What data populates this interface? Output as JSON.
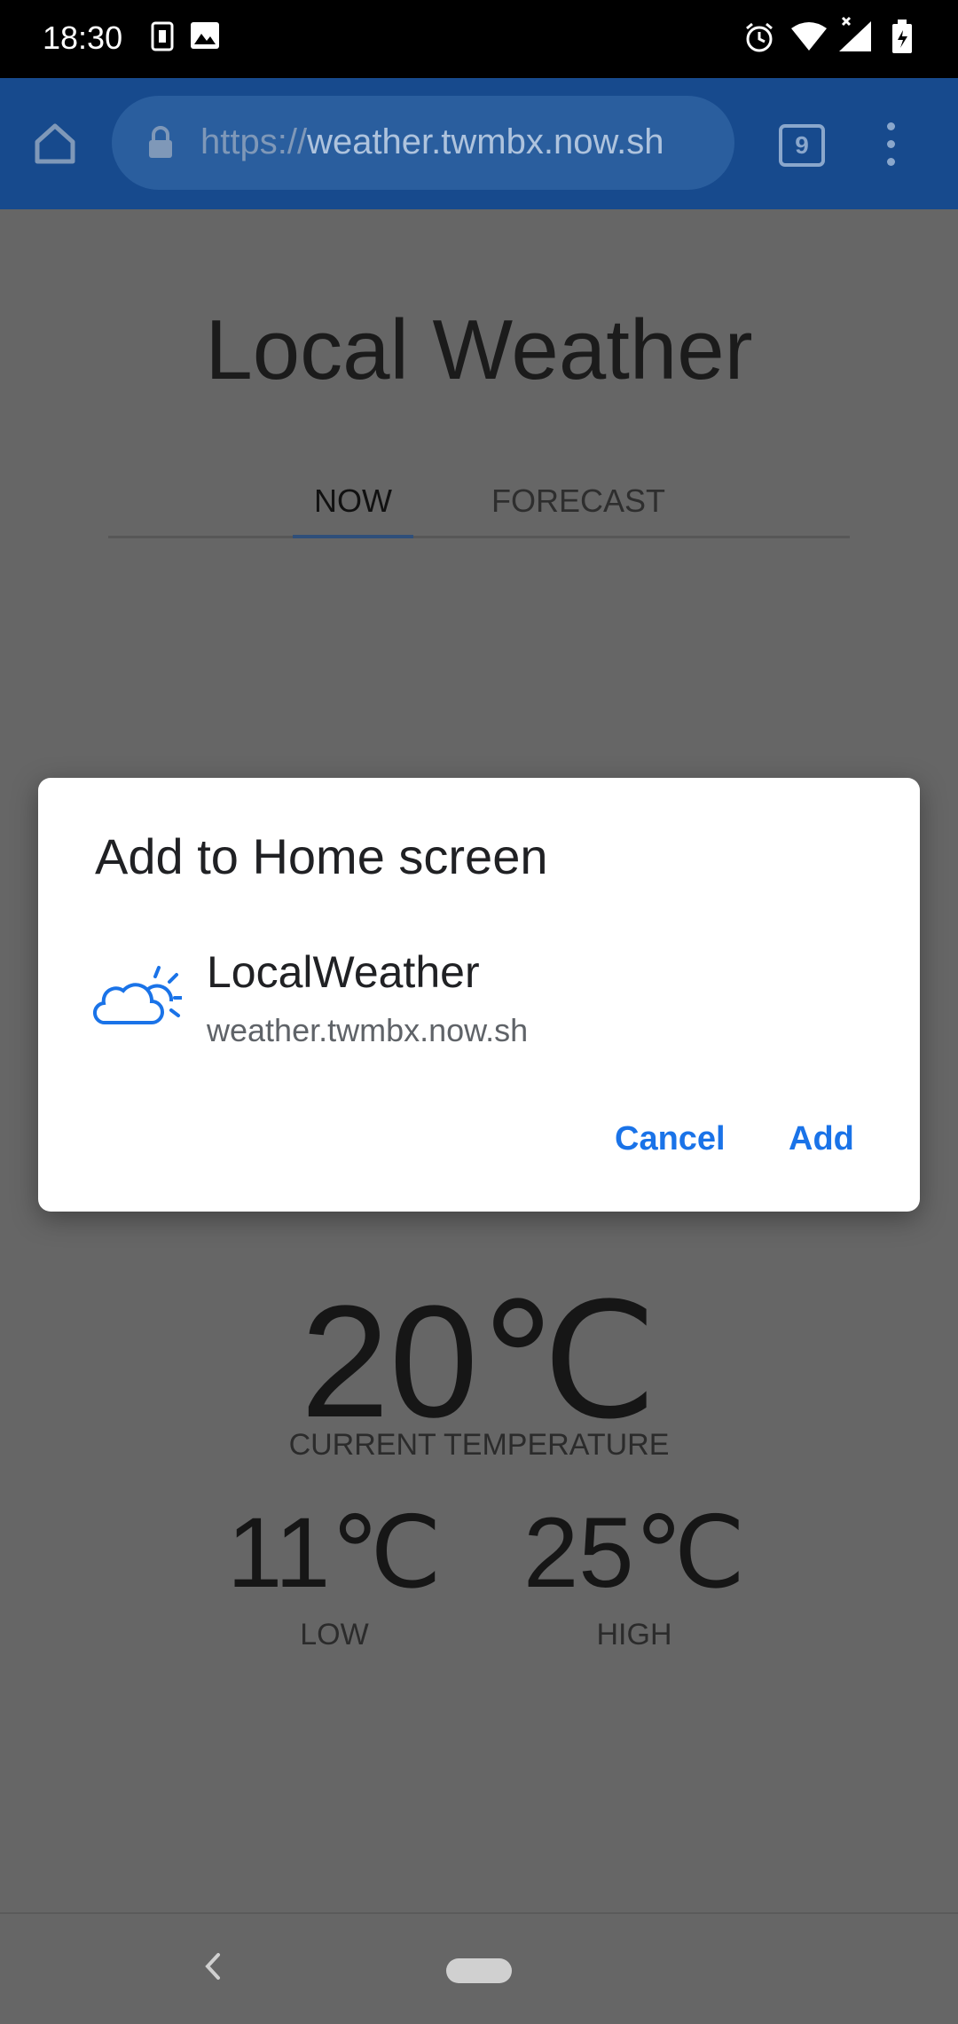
{
  "status_bar": {
    "time": "18:30",
    "icons": [
      "sim-card-icon",
      "image-icon",
      "alarm-icon",
      "wifi-icon",
      "signal-icon",
      "battery-icon"
    ]
  },
  "browser": {
    "url_scheme": "https://",
    "url_host": "weather.twmbx.now.sh",
    "tab_count": "9",
    "accent_color": "#174a8d"
  },
  "page": {
    "title": "Local Weather",
    "tabs": [
      {
        "label": "NOW",
        "active": true
      },
      {
        "label": "FORECAST",
        "active": false
      }
    ],
    "current_temp": "20℃",
    "current_label": "CURRENT TEMPERATURE",
    "low_temp": "11℃",
    "low_label": "LOW",
    "high_temp": "25℃",
    "high_label": "HIGH"
  },
  "dialog": {
    "title": "Add to Home screen",
    "app_name": "LocalWeather",
    "app_url": "weather.twmbx.now.sh",
    "cancel_label": "Cancel",
    "add_label": "Add",
    "button_color": "#1a73e8"
  }
}
